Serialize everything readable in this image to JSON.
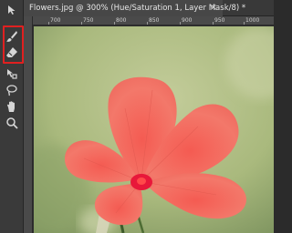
{
  "document_tab": {
    "title": "Flowers.jpg @ 300% (Hue/Saturation 1, Layer Mask/8) *",
    "close_glyph": "×"
  },
  "ruler": {
    "labels": [
      "700",
      "750",
      "800",
      "850",
      "900",
      "950",
      "1000"
    ]
  },
  "toolbar": {
    "tools": [
      {
        "name": "move-tool-icon",
        "highlighted": false
      },
      {
        "name": "brush-tool-icon",
        "highlighted": true
      },
      {
        "name": "eraser-tool-icon",
        "highlighted": true
      },
      {
        "name": "transform-tool-icon",
        "highlighted": false
      },
      {
        "name": "lasso-tool-icon",
        "highlighted": false
      },
      {
        "name": "hand-tool-icon",
        "highlighted": false
      },
      {
        "name": "zoom-tool-icon",
        "highlighted": false
      }
    ],
    "highlight_color": "#e02020"
  },
  "canvas": {
    "background_color": "#b4c18a",
    "petal_color": "#f27465",
    "center_color": "#e8183a"
  }
}
